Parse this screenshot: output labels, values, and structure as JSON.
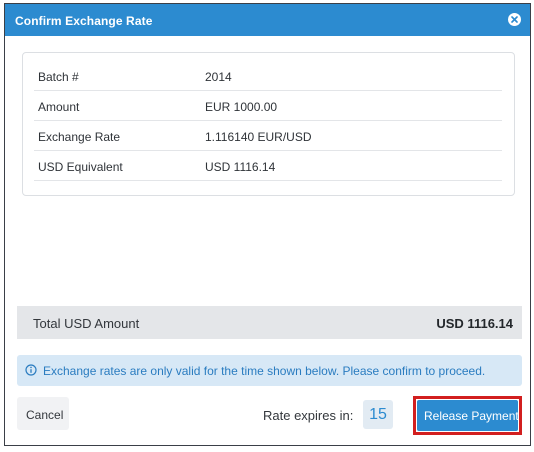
{
  "dialog": {
    "title": "Confirm Exchange Rate",
    "close_icon": "close-circle-icon"
  },
  "details": [
    {
      "label": "Batch #",
      "value": "2014"
    },
    {
      "label": "Amount",
      "value": "EUR 1000.00"
    },
    {
      "label": "Exchange Rate",
      "value": "1.116140 EUR/USD"
    },
    {
      "label": "USD Equivalent",
      "value": "USD 1116.14"
    }
  ],
  "total": {
    "label": "Total USD Amount",
    "value": "USD 1116.14"
  },
  "info": {
    "icon": "info-circle-icon",
    "message": "Exchange rates are only valid for the time shown below. Please confirm to proceed."
  },
  "footer": {
    "cancel_label": "Cancel",
    "expires_label": "Rate expires in:",
    "countdown": "15",
    "release_label": "Release Payment"
  },
  "colors": {
    "primary": "#2c8bd0",
    "highlight_outline": "#d21f1f",
    "info_background": "#d7e8f6",
    "total_background": "#e4e6e9"
  }
}
